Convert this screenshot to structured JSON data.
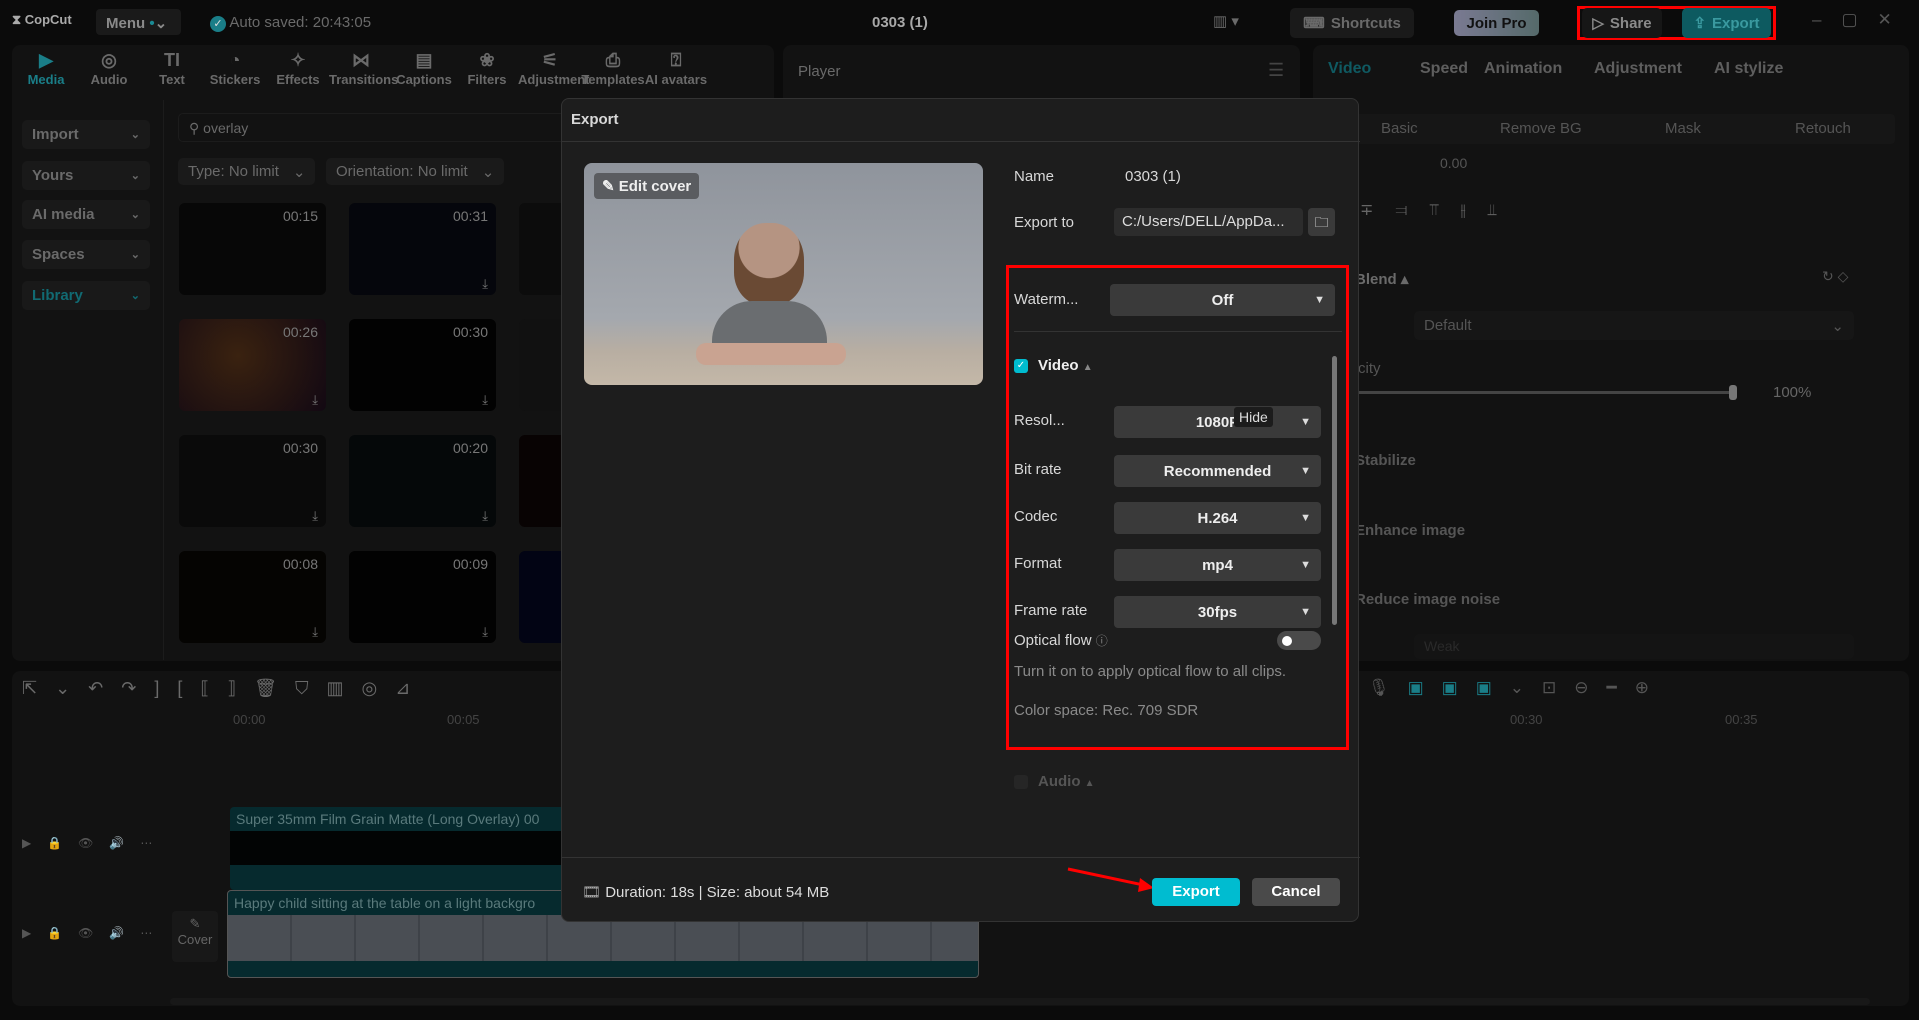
{
  "titlebar": {
    "logo": "CopCut",
    "menu": "Menu",
    "autosave": "Auto saved: 20:43:05",
    "project": "0303 (1)",
    "shortcuts": "Shortcuts",
    "join_pro": "Join Pro",
    "share": "Share",
    "export": "Export"
  },
  "media_tabs": [
    {
      "label": "Media",
      "icon": "media-icon"
    },
    {
      "label": "Audio",
      "icon": "audio-icon"
    },
    {
      "label": "Text",
      "icon": "text-icon"
    },
    {
      "label": "Stickers",
      "icon": "stickers-icon"
    },
    {
      "label": "Effects",
      "icon": "effects-icon"
    },
    {
      "label": "Transitions",
      "icon": "transitions-icon"
    },
    {
      "label": "Captions",
      "icon": "captions-icon"
    },
    {
      "label": "Filters",
      "icon": "filters-icon"
    },
    {
      "label": "Adjustment",
      "icon": "adjustment-icon"
    },
    {
      "label": "Templates",
      "icon": "templates-icon"
    },
    {
      "label": "AI avatars",
      "icon": "ai-avatars-icon"
    }
  ],
  "sidebar": [
    {
      "label": "Import"
    },
    {
      "label": "Yours"
    },
    {
      "label": "AI media"
    },
    {
      "label": "Spaces"
    },
    {
      "label": "Library"
    }
  ],
  "search": {
    "value": "overlay"
  },
  "filters": {
    "type": "Type: No limit",
    "orientation": "Orientation: No limit"
  },
  "thumbs": [
    "00:15",
    "00:31",
    "",
    "00:26",
    "00:30",
    "",
    "00:30",
    "00:20",
    "",
    "00:08",
    "00:09",
    ""
  ],
  "player": {
    "title": "Player"
  },
  "right_tabs": [
    "Video",
    "Speed",
    "Animation",
    "Adjustment",
    "AI stylize"
  ],
  "right_subtabs": [
    "Basic",
    "Remove BG",
    "Mask",
    "Retouch"
  ],
  "right_panel": {
    "rotate_value": "0.00",
    "blend": "Blend",
    "mode_value": "Default",
    "opacity_label": "city",
    "opacity_value": "100%",
    "opacity": 100,
    "stabilize": "Stabilize",
    "enhance": "Enhance image",
    "noise": "Reduce image noise",
    "noise_value": "Weak"
  },
  "timeline": {
    "ticks": [
      "00:00",
      "00:05",
      "00:30",
      "00:35"
    ],
    "clip1": "Super 35mm Film Grain Matte (Long Overlay)",
    "clip1_time": "00",
    "clip2": "Happy child sitting at the table on a light backgro",
    "cover": "Cover"
  },
  "dialog": {
    "title": "Export",
    "edit_cover": "Edit cover",
    "name_label": "Name",
    "name_value": "0303 (1)",
    "export_to_label": "Export to",
    "export_to_value": "C:/Users/DELL/AppDa...",
    "watermark_label": "Waterm...",
    "watermark_value": "Off",
    "video_label": "Video",
    "video_checked": true,
    "rows": [
      {
        "label": "Resol...",
        "value": "1080P"
      },
      {
        "label": "Bit rate",
        "value": "Recommended"
      },
      {
        "label": "Codec",
        "value": "H.264"
      },
      {
        "label": "Format",
        "value": "mp4"
      },
      {
        "label": "Frame rate",
        "value": "30fps"
      }
    ],
    "tooltip": "Hide",
    "optical_flow": "Optical flow",
    "optical_flow_on": false,
    "optical_desc": "Turn it on to apply optical flow to all clips.",
    "color_space": "Color space: Rec. 709 SDR",
    "audio_label": "Audio",
    "audio_checked": false,
    "footer": "Duration: 18s | Size: about 54 MB",
    "export_btn": "Export",
    "cancel_btn": "Cancel"
  },
  "colors": {
    "accent": "#00bcd0",
    "highlight": "#ff0000"
  }
}
